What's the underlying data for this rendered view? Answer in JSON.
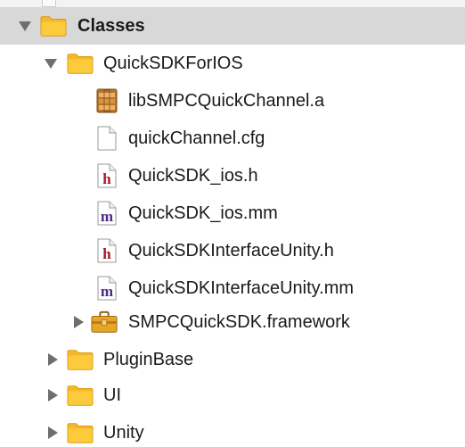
{
  "navigator": {
    "items": [
      {
        "label": "Classes",
        "kind": "folder",
        "expanded": true,
        "selected": true
      },
      {
        "label": "QuickSDKForIOS",
        "kind": "folder",
        "expanded": true,
        "selected": false
      },
      {
        "label": "libSMPCQuickChannel.a",
        "kind": "library",
        "selected": false
      },
      {
        "label": "quickChannel.cfg",
        "kind": "plain-file",
        "selected": false
      },
      {
        "label": "QuickSDK_ios.h",
        "kind": "header-file",
        "badge": "h",
        "selected": false
      },
      {
        "label": "QuickSDK_ios.mm",
        "kind": "objc-file",
        "badge": "m",
        "selected": false
      },
      {
        "label": "QuickSDKInterfaceUnity.h",
        "kind": "header-file",
        "badge": "h",
        "selected": false
      },
      {
        "label": "QuickSDKInterfaceUnity.mm",
        "kind": "objc-file",
        "badge": "m",
        "selected": false
      },
      {
        "label": "SMPCQuickSDK.framework",
        "kind": "framework",
        "expanded": false,
        "selected": false
      },
      {
        "label": "PluginBase",
        "kind": "folder",
        "expanded": false,
        "selected": false
      },
      {
        "label": "UI",
        "kind": "folder",
        "expanded": false,
        "selected": false
      },
      {
        "label": "Unity",
        "kind": "folder",
        "expanded": false,
        "selected": false
      }
    ]
  },
  "colors": {
    "selection_background": "#d8d8d8",
    "folder_fill": "#f5b826",
    "header_badge": "#a8162a",
    "objc_badge": "#4b2a86",
    "disclosure": "#6e6e6e"
  },
  "icons": {
    "folder": "folder-icon",
    "library": "library-archive-icon",
    "plain-file": "plain-document-icon",
    "header-file": "header-file-icon",
    "objc-file": "objc-source-file-icon",
    "framework": "framework-toolbox-icon"
  }
}
